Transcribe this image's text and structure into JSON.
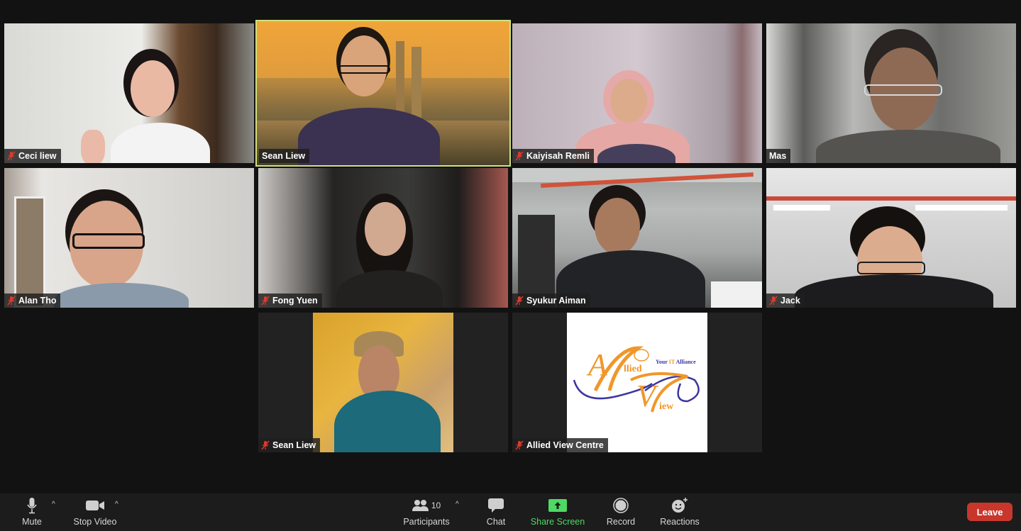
{
  "participants": [
    {
      "name": "Ceci liew",
      "muted": true,
      "active_speaker": false,
      "video": "on"
    },
    {
      "name": "Sean Liew",
      "muted": false,
      "active_speaker": true,
      "video": "on"
    },
    {
      "name": "Kaiyisah Remli",
      "muted": true,
      "active_speaker": false,
      "video": "on"
    },
    {
      "name": "Mas",
      "muted": false,
      "active_speaker": false,
      "video": "on"
    },
    {
      "name": "Alan Tho",
      "muted": true,
      "active_speaker": false,
      "video": "on"
    },
    {
      "name": "Fong Yuen",
      "muted": true,
      "active_speaker": false,
      "video": "on"
    },
    {
      "name": "Syukur Aiman",
      "muted": true,
      "active_speaker": false,
      "video": "on"
    },
    {
      "name": "Jack",
      "muted": true,
      "active_speaker": false,
      "video": "on"
    },
    {
      "name": "Sean Liew",
      "muted": true,
      "active_speaker": false,
      "video": "profile-photo"
    },
    {
      "name": "Allied View Centre",
      "muted": true,
      "active_speaker": false,
      "video": "profile-photo"
    }
  ],
  "logo": {
    "tagline_prefix": "Your ",
    "tagline_highlight": "IT",
    "tagline_suffix": " Alliance",
    "word1_initial": "A",
    "word1_rest": "llied",
    "word2_initial": "V",
    "word2_rest": "iew"
  },
  "toolbar": {
    "mute_label": "Mute",
    "stop_video_label": "Stop Video",
    "participants_label": "Participants",
    "participants_count": "10",
    "chat_label": "Chat",
    "share_screen_label": "Share Screen",
    "record_label": "Record",
    "reactions_label": "Reactions",
    "leave_label": "Leave",
    "caret": "^"
  },
  "colors": {
    "active_speaker_border": "#cfe27a",
    "share_green": "#4ed964",
    "leave_red": "#c9372c",
    "muted_icon_red": "#e0392b",
    "background": "#121212",
    "toolbar": "#1c1c1c"
  }
}
